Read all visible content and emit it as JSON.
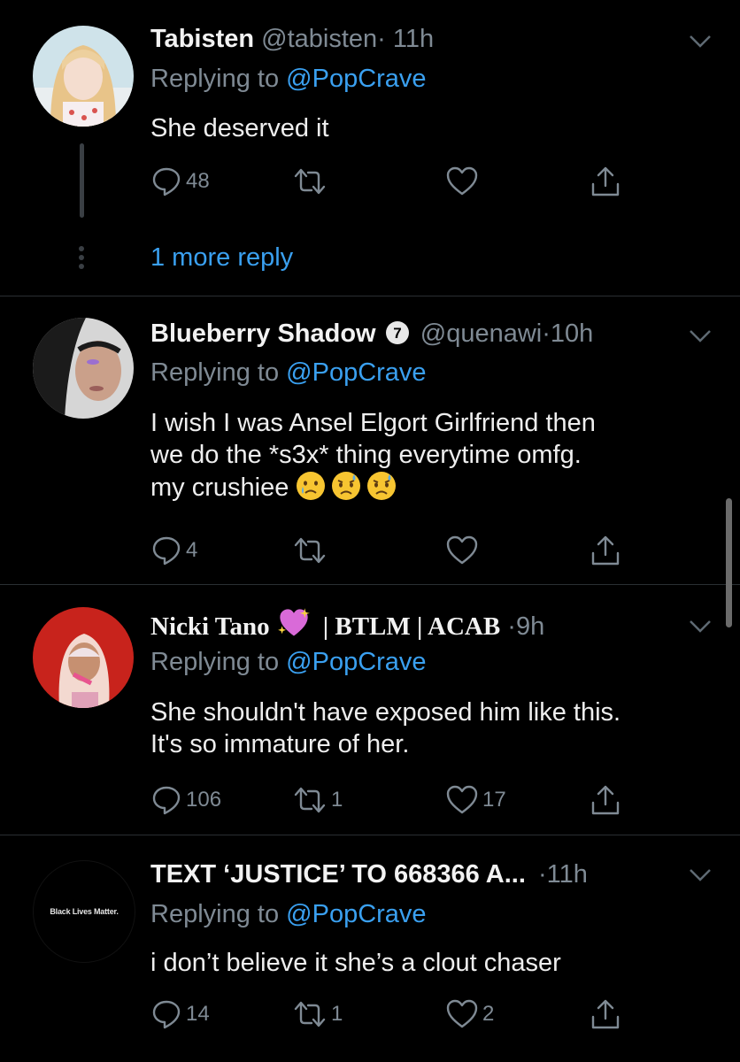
{
  "colors": {
    "background": "#000000",
    "link": "#3aa0f0",
    "muted": "#7f8a94",
    "text": "#eeeeee"
  },
  "thread_more": {
    "label": "1 more reply"
  },
  "tweets": [
    {
      "name": "Tabisten",
      "handle": "@tabisten",
      "dot": "·",
      "time": "11h",
      "replying_prefix": "Replying to ",
      "replying_to": "@PopCrave",
      "text": "She deserved it",
      "reply_count": "48",
      "retweet_count": "",
      "like_count": "",
      "avatar_icon": "avatar-photo"
    },
    {
      "name": "Blueberry Shadow",
      "badge": "7",
      "handle": "@quenawi",
      "dot": "·",
      "time": "10h",
      "replying_prefix": "Replying to ",
      "replying_to": "@PopCrave",
      "text_lines": [
        "I wish I was Ansel Elgort Girlfriend then",
        "we do the *s3x* thing everytime omfg.",
        "my crushiee"
      ],
      "emojis": [
        "sad-relieved-face",
        "disappointed-relieved-face",
        "disappointed-relieved-face"
      ],
      "reply_count": "4",
      "retweet_count": "",
      "like_count": "",
      "avatar_icon": "avatar-photo"
    },
    {
      "name": "Nicki Tano",
      "name_suffix": "| BTLM | ACAB",
      "name_emoji": "sparkling-heart",
      "dot": "·",
      "time": "9h",
      "replying_prefix": "Replying to ",
      "replying_to": "@PopCrave",
      "text_lines": [
        "She shouldn't have exposed him like this.",
        "It's so immature of her."
      ],
      "reply_count": "106",
      "retweet_count": "1",
      "like_count": "17",
      "avatar_icon": "avatar-photo"
    },
    {
      "name": "TEXT ‘JUSTICE’ TO 668366 A...",
      "dot": "·",
      "time": "11h",
      "replying_prefix": "Replying to ",
      "replying_to": "@PopCrave",
      "text": "i don’t believe it she’s a clout chaser",
      "reply_count": "14",
      "retweet_count": "1",
      "like_count": "2",
      "avatar_text": "Black Lives Matter."
    }
  ]
}
